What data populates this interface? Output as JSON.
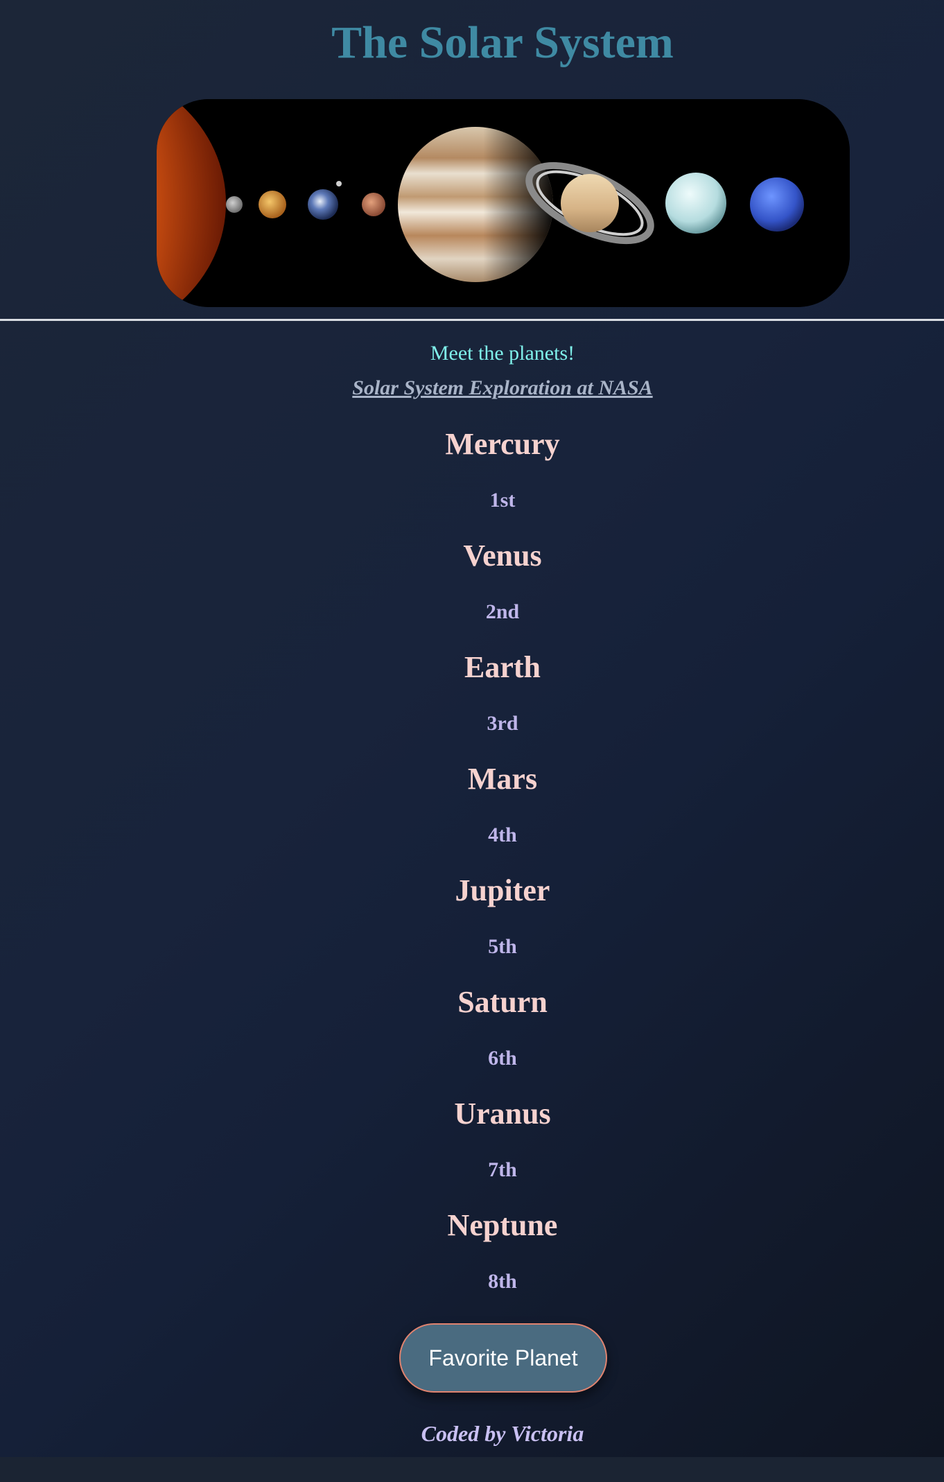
{
  "title": "The Solar System",
  "banner_alt": "Solar system planets banner",
  "intro": "Meet the planets!",
  "nasa_link": "Solar System Exploration at NASA",
  "planets": [
    {
      "name": "Mercury",
      "order": "1st"
    },
    {
      "name": "Venus",
      "order": "2nd"
    },
    {
      "name": "Earth",
      "order": "3rd"
    },
    {
      "name": "Mars",
      "order": "4th"
    },
    {
      "name": "Jupiter",
      "order": "5th"
    },
    {
      "name": "Saturn",
      "order": "6th"
    },
    {
      "name": "Uranus",
      "order": "7th"
    },
    {
      "name": "Neptune",
      "order": "8th"
    }
  ],
  "button": {
    "label": "Favorite Planet"
  },
  "footer": "Coded by Victoria",
  "colors": {
    "title": "#3f8aa3",
    "intro": "#7ff0ea",
    "planet_name": "#f6d2cf",
    "planet_order": "#bfb6ea",
    "button_bg": "#4a6b80",
    "button_border": "#e0836f"
  }
}
